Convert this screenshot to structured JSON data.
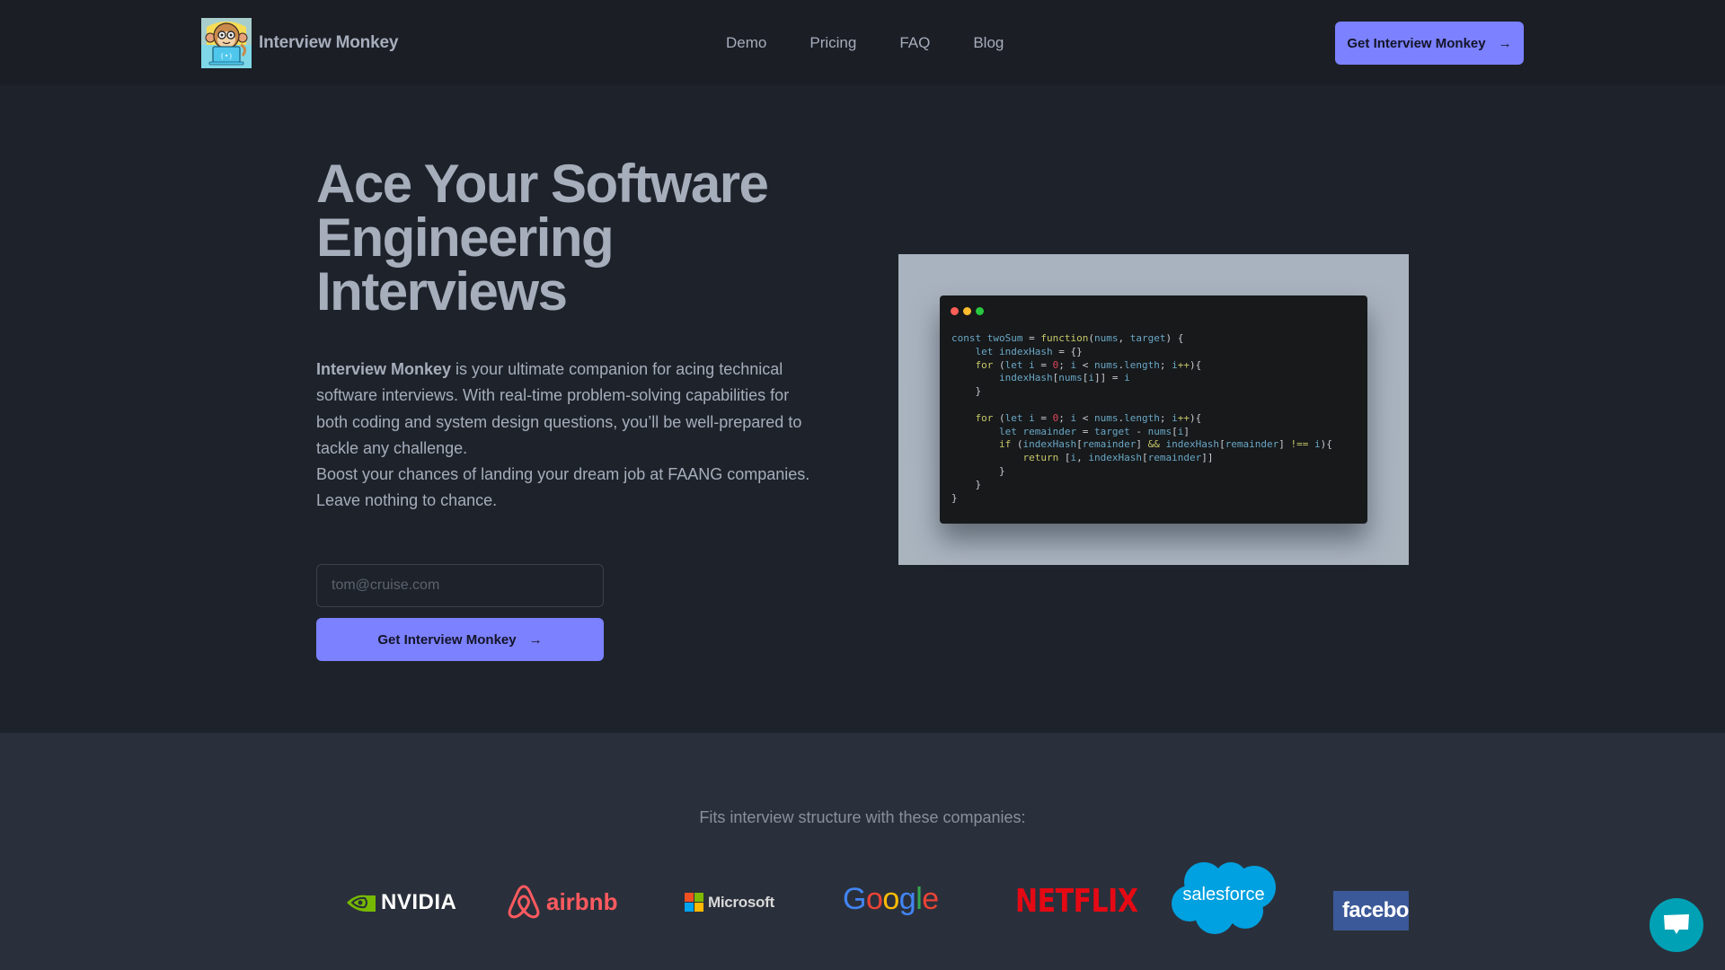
{
  "nav": {
    "brand_name": "Interview Monkey",
    "links": [
      {
        "label": "Demo"
      },
      {
        "label": "Pricing"
      },
      {
        "label": "FAQ"
      },
      {
        "label": "Blog"
      }
    ],
    "cta_label": "Get Interview Monkey",
    "cta_icon": "arrow-right-icon"
  },
  "hero": {
    "headline": "Ace Your Software Engineering Interviews",
    "description_brand": "Interview Monkey",
    "description_rest": " is your ultimate companion for acing technical software interviews. With real-time problem-solving capabilities for both coding and system design questions, you’ll be well-prepared to tackle any challenge.",
    "description_line2": "Boost your chances of landing your dream job at FAANG companies. Leave nothing to chance.",
    "email_placeholder": "tom@cruise.com",
    "email_value": "",
    "cta_label": "Get Interview Monkey",
    "code_window": {
      "dot_colors": [
        "#ff5f57",
        "#febc2e",
        "#28c840"
      ],
      "lines": [
        "const twoSum = function(nums, target) {",
        "    let indexHash = {}",
        "    for (let i = 0; i < nums.length; i++){",
        "        indexHash[nums[i]] = i",
        "    }",
        "",
        "    for (let i = 0; i < nums.length; i++){",
        "        let remainder = target - nums[i]",
        "        if (indexHash[remainder] && indexHash[remainder] !== i){",
        "            return [i, indexHash[remainder]]",
        "        }",
        "    }",
        "}"
      ]
    }
  },
  "companies": {
    "title": "Fits interview structure with these companies:",
    "logos": [
      {
        "name": "NVIDIA",
        "color": "#76b900"
      },
      {
        "name": "airbnb",
        "color": "#ff5a5f"
      },
      {
        "name": "Microsoft",
        "colors": [
          "#f25022",
          "#7fba00",
          "#00a4ef",
          "#ffb900"
        ]
      },
      {
        "name": "Google",
        "letters": [
          {
            "ch": "G",
            "color": "#4285f4"
          },
          {
            "ch": "o",
            "color": "#ea4335"
          },
          {
            "ch": "o",
            "color": "#fbbc05"
          },
          {
            "ch": "g",
            "color": "#4285f4"
          },
          {
            "ch": "l",
            "color": "#34a853"
          },
          {
            "ch": "e",
            "color": "#ea4335"
          }
        ]
      },
      {
        "name": "NETFLIX",
        "color": "#e50914"
      },
      {
        "name": "salesforce",
        "color": "#00a1e0"
      },
      {
        "name": "facebo",
        "color": "#3b5998"
      }
    ]
  },
  "chat": {
    "icon": "chat-bubble-icon",
    "color": "#00a1b5"
  },
  "colors": {
    "accent": "#7b81ff",
    "nav_bg": "#1b1e25",
    "hero_bg": "#1e232b",
    "companies_bg": "#2a303b",
    "text": "#a6adbb"
  }
}
